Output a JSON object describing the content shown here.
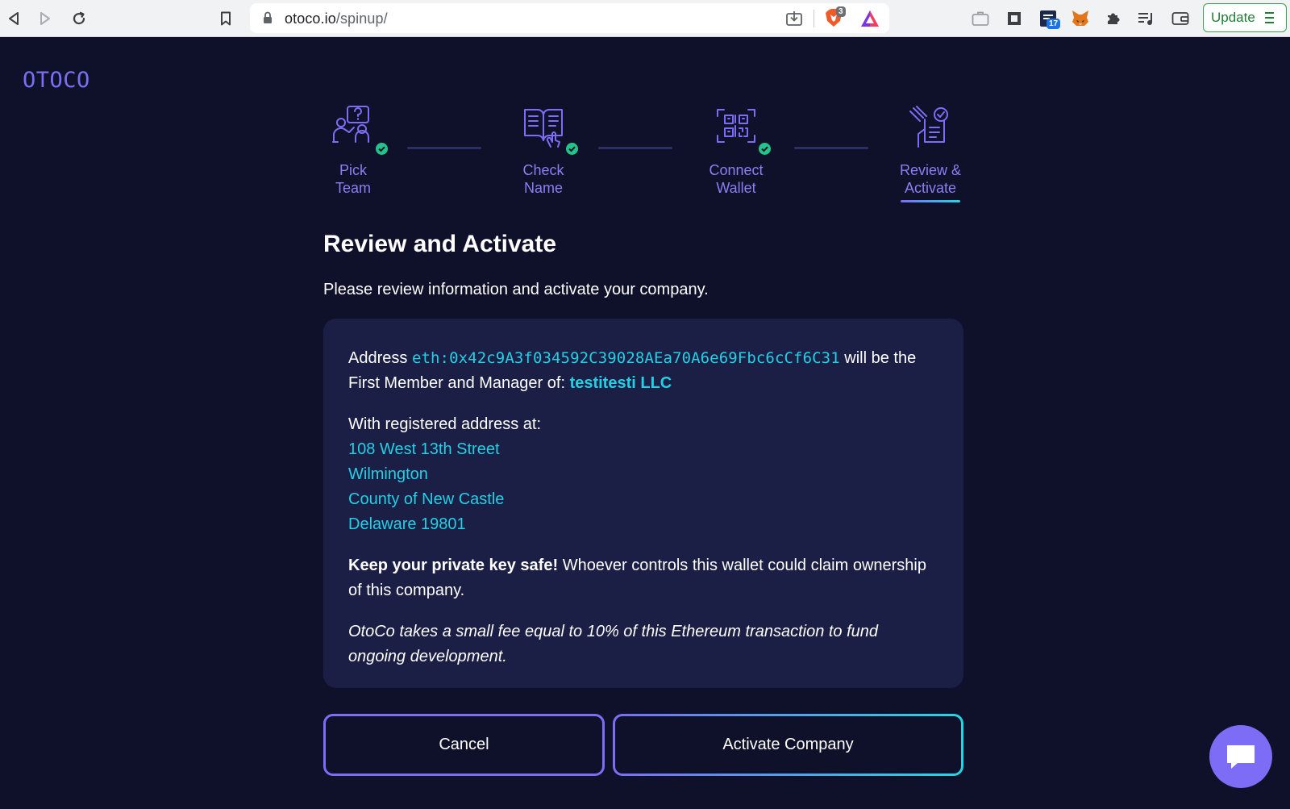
{
  "browser": {
    "url_host": "otoco.io",
    "url_path": "/spinup/",
    "brave_badge": "3",
    "calendar_badge": "17",
    "update_label": "Update"
  },
  "logo": "OTOCO",
  "steps": [
    {
      "label_1": "Pick",
      "label_2": "Team",
      "done": true
    },
    {
      "label_1": "Check",
      "label_2": "Name",
      "done": true
    },
    {
      "label_1": "Connect",
      "label_2": "Wallet",
      "done": true
    },
    {
      "label_1": "Review &",
      "label_2": "Activate",
      "done": false,
      "current": true
    }
  ],
  "review": {
    "title": "Review and Activate",
    "subtitle": "Please review information and activate your company.",
    "address_prefix": "Address",
    "wallet_address": "eth:0x42c9A3f034592C39028AEa70A6e69Fbc6cCf6C31",
    "member_text": "will be the First Member and Manager of:",
    "company_name": "testitesti LLC",
    "registered_label": "With registered address at:",
    "registered_address": [
      "108 West 13th Street",
      "Wilmington",
      "County of New Castle",
      "Delaware 19801"
    ],
    "warning_bold": "Keep your private key safe!",
    "warning_text": "Whoever controls this wallet could claim ownership of this company.",
    "fee_note": "OtoCo takes a small fee equal to 10% of this Ethereum transaction to fund ongoing development."
  },
  "buttons": {
    "cancel": "Cancel",
    "activate": "Activate Company"
  },
  "colors": {
    "background": "#0f1029",
    "card": "#1b1e45",
    "accent_purple": "#7d6cf6",
    "accent_cyan": "#22d1e4",
    "check_green": "#23c38a"
  }
}
